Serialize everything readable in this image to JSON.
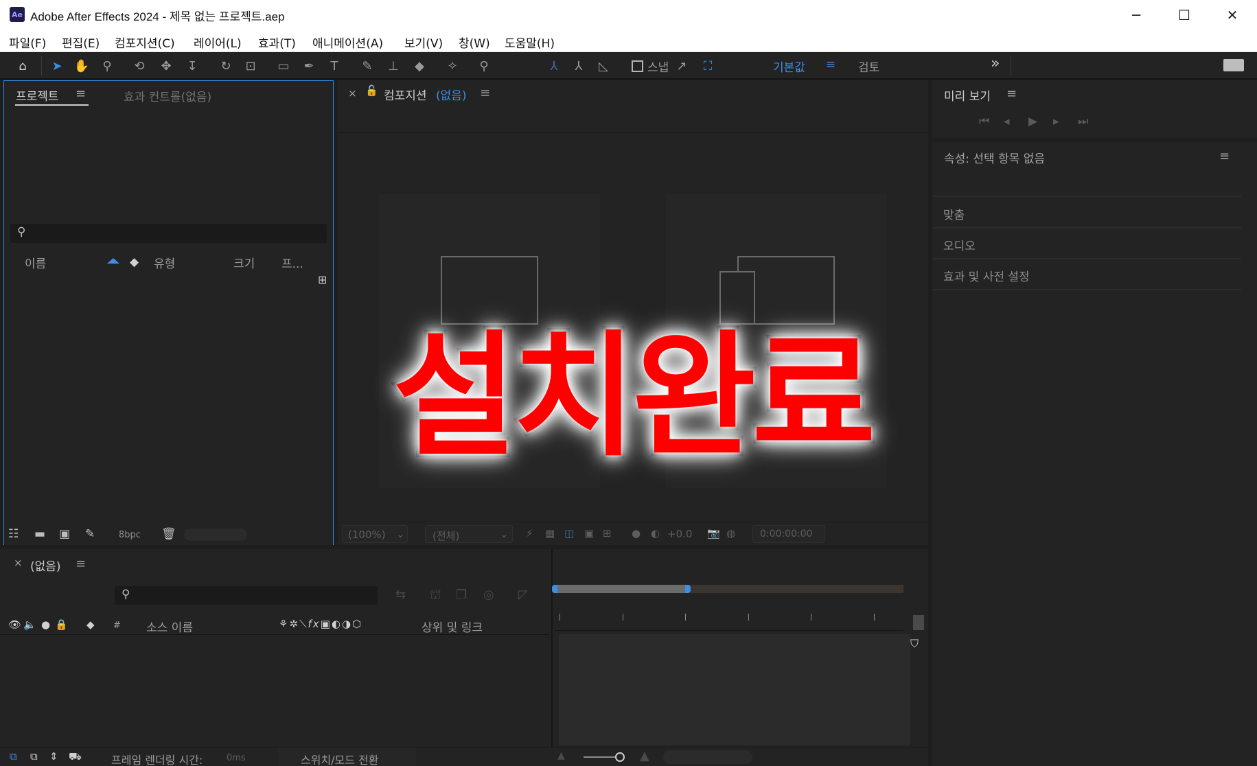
{
  "window": {
    "app_icon": "Ae",
    "title": "Adobe After Effects 2024 - 제목 없는 프로젝트.aep",
    "minimize": "─",
    "maximize": "☐",
    "close": "✕"
  },
  "menu": [
    "파일(F)",
    "편집(E)",
    "컴포지션(C)",
    "레이어(L)",
    "효과(T)",
    "애니메이션(A)",
    "보기(V)",
    "창(W)",
    "도움말(H)"
  ],
  "toolbar": {
    "snap_label": "스냅",
    "workspace_default": "기본값",
    "workspace_review": "검토",
    "more": "»"
  },
  "project_panel": {
    "tab_project": "프로젝트",
    "tab_effects": "효과 컨트롤(없음)",
    "col_name": "이름",
    "col_type": "유형",
    "col_size": "크기",
    "col_other": "프...",
    "bpc": "8bpc"
  },
  "comp_panel": {
    "title": "컴포지션",
    "none": "(없음)",
    "zoom": "(100%)",
    "resolution": "(전체)",
    "exposure": "+0.0",
    "timecode": "0:00:00:00"
  },
  "overlay": {
    "text": "설치완료"
  },
  "right_panel": {
    "preview_title": "미리 보기",
    "properties_title": "속성: 선택 항목 없음",
    "sections": [
      "맞춤",
      "오디오",
      "효과 및 사전 설정"
    ]
  },
  "timeline": {
    "title": "(없음)",
    "col_hash": "#",
    "col_source": "소스 이름",
    "col_parent": "상위 및 링크",
    "render_time_label": "프레임 렌더링 시간:",
    "render_time_value": "0ms",
    "switch_mode": "스위치/모드 전환"
  },
  "colors": {
    "accent": "#2d8ceb",
    "panel": "#232323",
    "overlay_fill": "#ff0000"
  }
}
